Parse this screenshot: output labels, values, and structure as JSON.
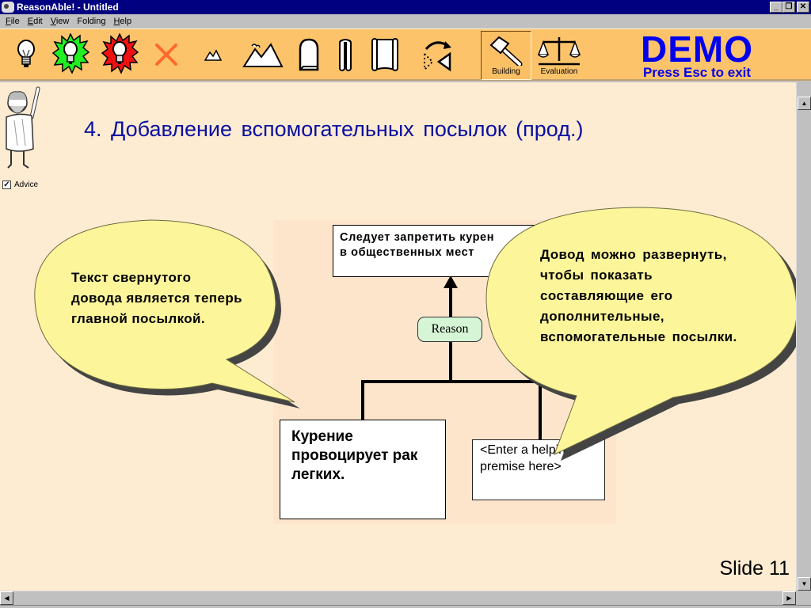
{
  "window": {
    "title": "ReasonAble! - Untitled",
    "controls": {
      "minimize": "_",
      "restore": "❐",
      "close": "✕"
    }
  },
  "menu": {
    "items": [
      {
        "label": "File",
        "accel": "F",
        "rest": "ile"
      },
      {
        "label": "Edit",
        "accel": "E",
        "rest": "dit"
      },
      {
        "label": "View",
        "accel": "V",
        "rest": "iew"
      },
      {
        "label": "Folding",
        "accel": "",
        "rest": "Folding"
      },
      {
        "label": "Help",
        "accel": "H",
        "rest": "elp"
      }
    ]
  },
  "toolbar": {
    "tools": [
      {
        "name": "claim-bulb",
        "icon": "lightbulb-icon"
      },
      {
        "name": "reason-bulb",
        "icon": "lightbulb-green-burst-icon"
      },
      {
        "name": "objection-bulb",
        "icon": "lightbulb-red-burst-icon"
      },
      {
        "name": "delete",
        "icon": "delete-x-icon"
      },
      {
        "name": "zoom-out",
        "icon": "small-mountain-icon"
      },
      {
        "name": "zoom-in",
        "icon": "large-mountain-icon"
      },
      {
        "name": "tablet",
        "icon": "tombstone-icon"
      },
      {
        "name": "scroll-closed",
        "icon": "scroll-closed-icon"
      },
      {
        "name": "scroll-open",
        "icon": "scroll-open-icon"
      },
      {
        "name": "flip",
        "icon": "flip-arrow-icon"
      }
    ],
    "modes": [
      {
        "label": "Building",
        "icon": "hammer-icon",
        "active": true
      },
      {
        "label": "Evaluation",
        "icon": "scales-icon",
        "active": false
      }
    ],
    "colors": {
      "background": "#fdc36b",
      "delete": "#ff6a2c"
    }
  },
  "demo": {
    "title": "DEMO",
    "subtitle": "Press Esc to exit",
    "color": "#0000ee"
  },
  "advisor": {
    "checkbox_label": "Advice",
    "checked": true
  },
  "slide": {
    "title": "4. Добавление вспомогательных посылок (прод.)",
    "number_label": "Slide 11",
    "title_color": "#0a10a0",
    "background": "#fdebd2"
  },
  "diagram": {
    "claim": "Следует запретить курение в общественных местах",
    "claim_visible_lines": [
      "Следует запретить курен",
      "в общественных мест"
    ],
    "reason_tag": "Reason",
    "premise": "Курение провоцирует рак легких.",
    "helping_premise": "<Enter a helping premise here>"
  },
  "callouts": {
    "left": "Текст свернутого довода является теперь главной посылкой.",
    "right": "Довод можно развернуть, чтобы показать составляющие его дополнительные, вспомогательные посылки.",
    "fill": "#fdf59a"
  },
  "scrollbars": {
    "up": "▲",
    "down": "▼",
    "left": "◀",
    "right": "▶"
  }
}
